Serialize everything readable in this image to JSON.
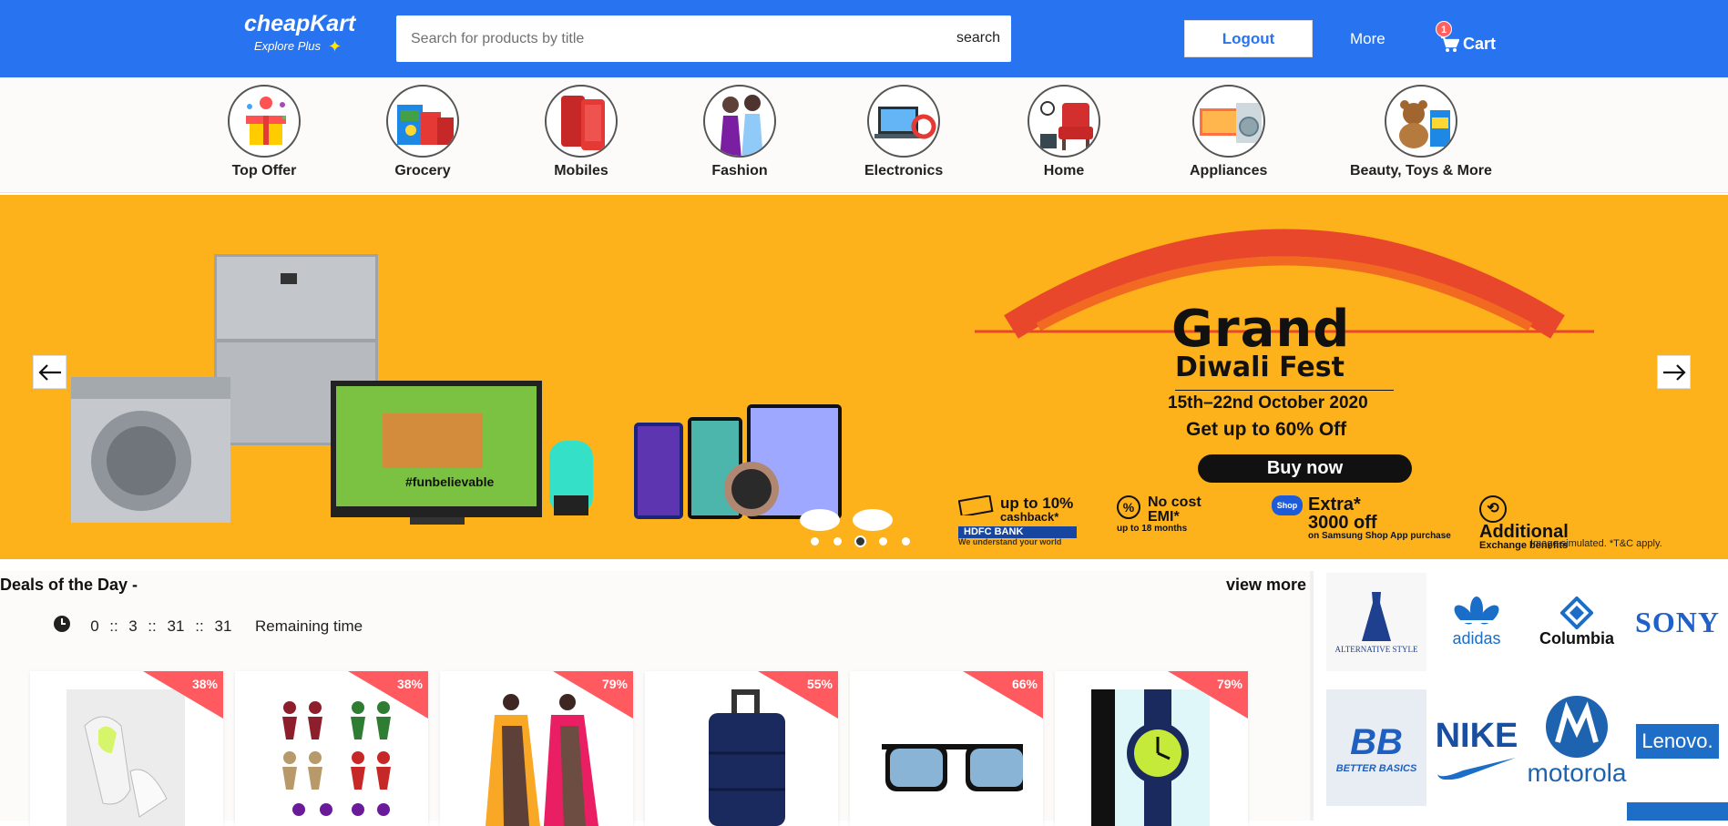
{
  "header": {
    "logo_name": "cheapKart",
    "logo_sub": "Explore Plus",
    "search_placeholder": "Search for products by title",
    "search_button": "search",
    "logout_label": "Logout",
    "more_label": "More",
    "cart_label": "Cart",
    "cart_count": "1"
  },
  "categories": [
    {
      "label": "Top Offer"
    },
    {
      "label": "Grocery"
    },
    {
      "label": "Mobiles"
    },
    {
      "label": "Fashion"
    },
    {
      "label": "Electronics"
    },
    {
      "label": "Home"
    },
    {
      "label": "Appliances"
    },
    {
      "label": "Beauty, Toys & More"
    }
  ],
  "banner": {
    "title_line1": "Grand",
    "title_line2": "Diwali Fest",
    "dates": "15th–22nd October 2020",
    "offer": "Get up to 60% Off",
    "cta": "Buy now",
    "tv_text": "#funbelievable",
    "benefits": [
      {
        "main": "up to 10%",
        "sub": "cashback*"
      },
      {
        "main": "No cost EMI*",
        "sub": "up to 18 months"
      },
      {
        "main": "Extra* 3000 off",
        "sub": "on Samsung Shop App purchase"
      },
      {
        "main": "Additional",
        "sub": "Exchange benefits"
      }
    ],
    "bank_label": "HDFC BANK",
    "bank_sub": "We understand your world",
    "fine_print": "Image simulated. *T&C apply.",
    "active_slide": 3,
    "slide_count": 5
  },
  "deals": {
    "title": "Deals of the Day -",
    "view_more": "view more",
    "timer": {
      "d": "0",
      "h": "3",
      "m": "31",
      "s": "31",
      "sep": "::",
      "label": "Remaining time"
    },
    "products": [
      {
        "discount": "38%",
        "art": "shoe"
      },
      {
        "discount": "38%",
        "art": "earrings"
      },
      {
        "discount": "79%",
        "art": "saree"
      },
      {
        "discount": "55%",
        "art": "luggage"
      },
      {
        "discount": "66%",
        "art": "sunglasses"
      },
      {
        "discount": "79%",
        "art": "watch"
      }
    ]
  },
  "brands": [
    {
      "name": "ALTERNATIVE STYLE",
      "color": "#1f3f8f"
    },
    {
      "name": "adidas",
      "color": "#1a6ec8"
    },
    {
      "name": "Columbia",
      "color": "#111111"
    },
    {
      "name": "SONY",
      "color": "#2060c8"
    },
    {
      "name": "BETTER BASICS",
      "color": "#1f5fbf"
    },
    {
      "name": "NIKE",
      "color": "#1a4fa0"
    },
    {
      "name": "motorola",
      "color": "#1e63b0"
    },
    {
      "name": "Lenovo.",
      "color": "#ffffff"
    }
  ],
  "colors": {
    "primary": "#2874f0",
    "banner": "#fdb21b",
    "discount": "#ff5a5f"
  }
}
